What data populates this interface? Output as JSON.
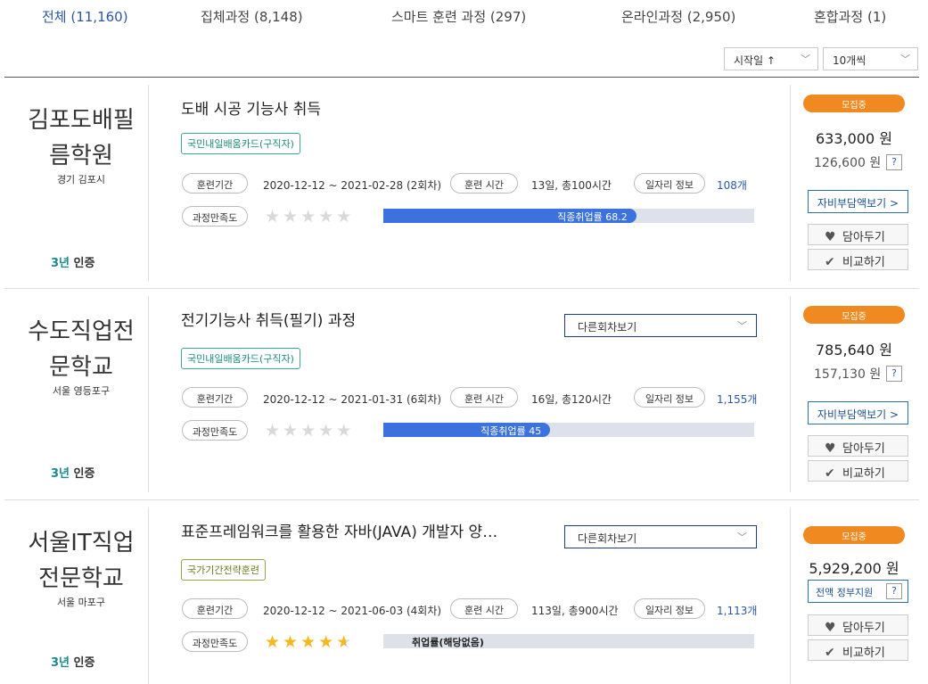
{
  "tabs": [
    {
      "label": "전체 (11,160)"
    },
    {
      "label": "집체과정 (8,148)"
    },
    {
      "label": "스마트 훈련 과정 (297)"
    },
    {
      "label": "온라인과정 (2,950)"
    },
    {
      "label": "혼합과정 (1)"
    }
  ],
  "sort": {
    "label": "시작일 ↑",
    "options": []
  },
  "page_size": {
    "label": "10개씩"
  },
  "common": {
    "period_label": "훈련기간",
    "hours_label": "훈련 시간",
    "job_label": "일자리 정보",
    "satisfaction_label": "과정만족도",
    "other_rounds_label": "다른회차보기",
    "recruiting_label": "모집중",
    "self_pay_label": "자비부담액보기 >",
    "wish_label": "담아두기",
    "compare_label": "비교하기",
    "help_mark": "?",
    "cert_num": "3년",
    "cert_label": "인증"
  },
  "courses": [
    {
      "inst_line1": "김포도배필",
      "inst_line2": "름학원",
      "location": "경기 김포시",
      "title": "도배 시공 기능사 취득",
      "tag": "국민내일배움카드(구직자)",
      "period": "2020-12-12 ~ 2021-02-28 (2회차)",
      "hours": "13일, 총100시간",
      "jobs": "108개",
      "rating": 0,
      "bar_label": "직종취업률 68.2",
      "bar_value": 68.2,
      "price": "633,000 원",
      "subprice": "126,600 원"
    },
    {
      "inst_line1": "수도직업전",
      "inst_line2": "문학교",
      "location": "서울 영등포구",
      "title": "전기기능사 취득(필기) 과정",
      "tag": "국민내일배움카드(구직자)",
      "period": "2020-12-12 ~ 2021-01-31 (6회차)",
      "hours": "16일, 총120시간",
      "jobs": "1,155개",
      "rating": 0,
      "bar_label": "직종취업률 45",
      "bar_value": 45,
      "price": "785,640 원",
      "subprice": "157,130 원"
    },
    {
      "inst_line1": "서울IT직업",
      "inst_line2": "전문학교",
      "location": "서울 마포구",
      "title": "표준프레임워크를 활용한 자바(JAVA) 개발자 양…",
      "tag": "국가기간전략훈련",
      "period": "2020-12-12 ~ 2021-06-03 (4회차)",
      "hours": "113일, 총900시간",
      "jobs": "1,113개",
      "rating": 4.5,
      "bar_label": "취업률(해당없음)",
      "bar_value": 0,
      "price": "5,929,200 원",
      "gov_label": "전액 정부지원"
    }
  ]
}
